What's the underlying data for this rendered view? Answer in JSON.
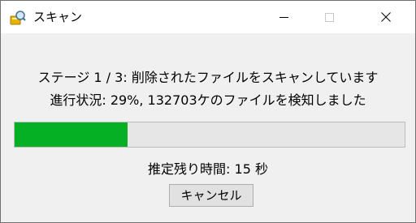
{
  "window": {
    "title": "スキャン",
    "icon": "scan-app-icon",
    "controls": {
      "minimize": "minimize-icon",
      "maximize": "maximize-icon",
      "close": "close-icon"
    }
  },
  "scan": {
    "stage_text": "ステージ 1 / 3: 削除されたファイルをスキャンしています",
    "progress_text": "進行状況: 29%, 132703ケのファイルを検知しました",
    "progress_fraction": 0.29,
    "remaining_text": "推定残り時間: 15 秒"
  },
  "buttons": {
    "cancel_label": "キャンセル"
  },
  "colors": {
    "progress_fill": "#06b025",
    "progress_track": "#e6e6e6",
    "window_background": "#f0f0f0",
    "titlebar_background": "#ffffff"
  }
}
